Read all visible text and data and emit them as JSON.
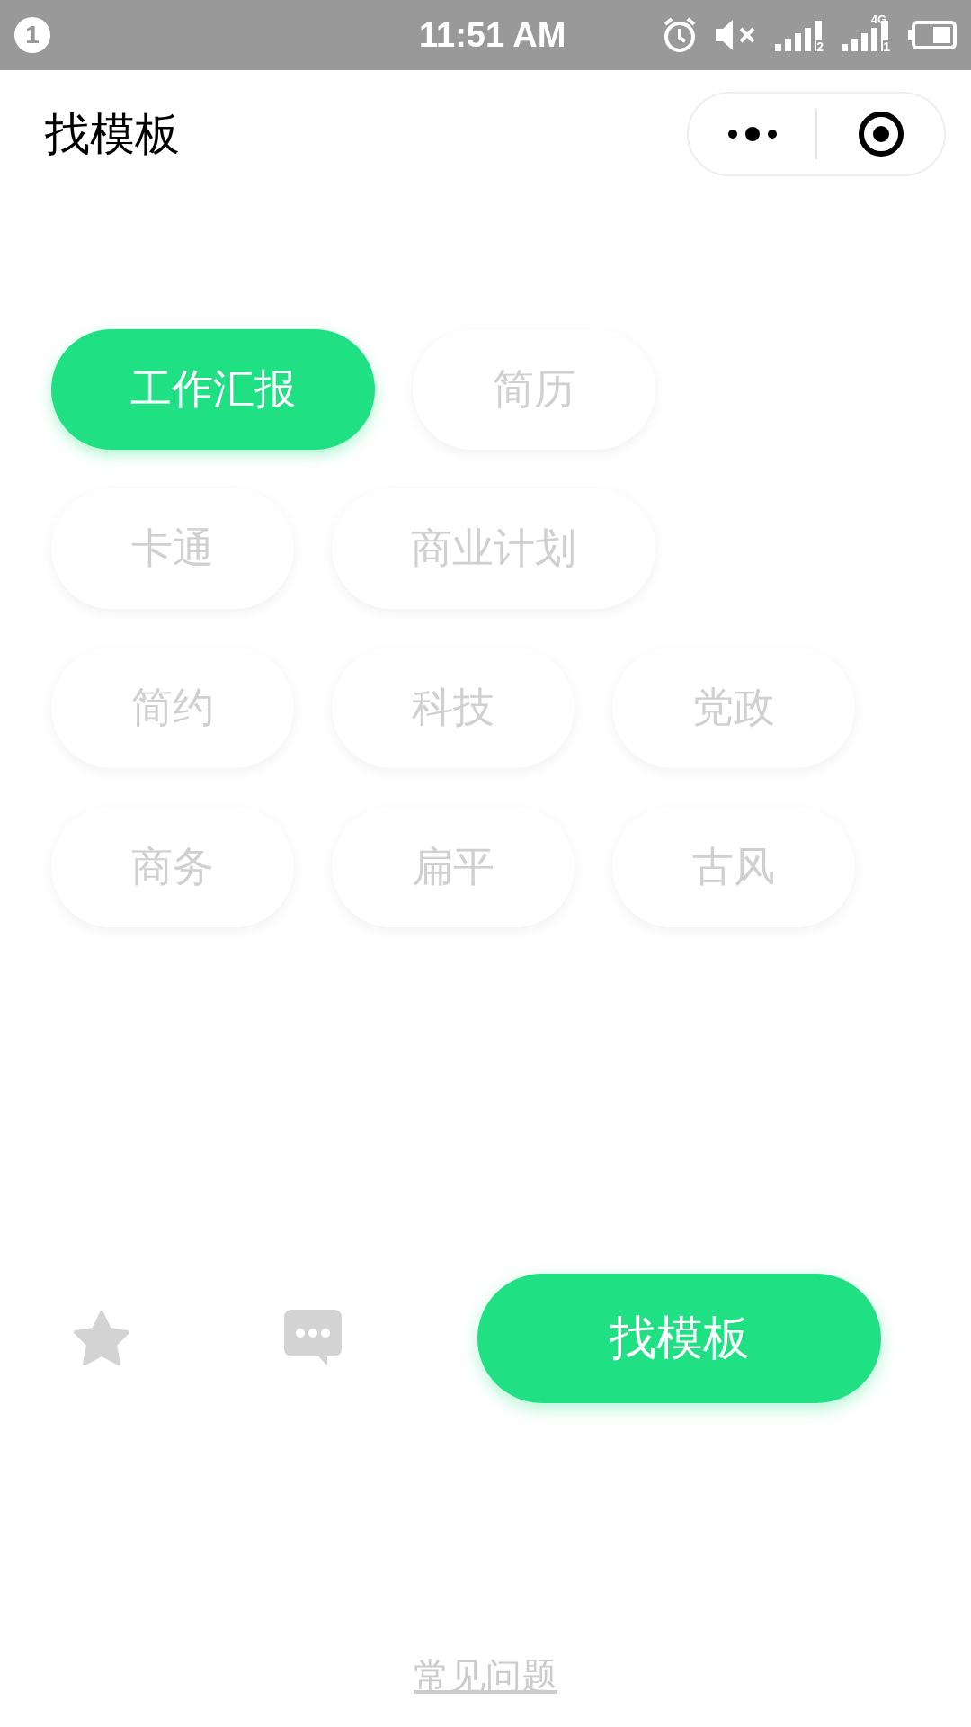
{
  "status_bar": {
    "notification_count": "1",
    "time": "11:51 AM",
    "signals": [
      {
        "sim": "2"
      },
      {
        "network": "4G",
        "sim": "1"
      }
    ]
  },
  "header": {
    "title": "找模板"
  },
  "category_rows": [
    [
      {
        "label": "工作汇报",
        "selected": true
      },
      {
        "label": "简历",
        "selected": false
      }
    ],
    [
      {
        "label": "卡通",
        "selected": false
      },
      {
        "label": "商业计划",
        "selected": false
      }
    ],
    [
      {
        "label": "简约",
        "selected": false
      },
      {
        "label": "科技",
        "selected": false
      },
      {
        "label": "党政",
        "selected": false
      }
    ],
    [
      {
        "label": "商务",
        "selected": false
      },
      {
        "label": "扁平",
        "selected": false
      },
      {
        "label": "古风",
        "selected": false
      }
    ]
  ],
  "action_button": "找模板",
  "faq_link": "常见问题"
}
